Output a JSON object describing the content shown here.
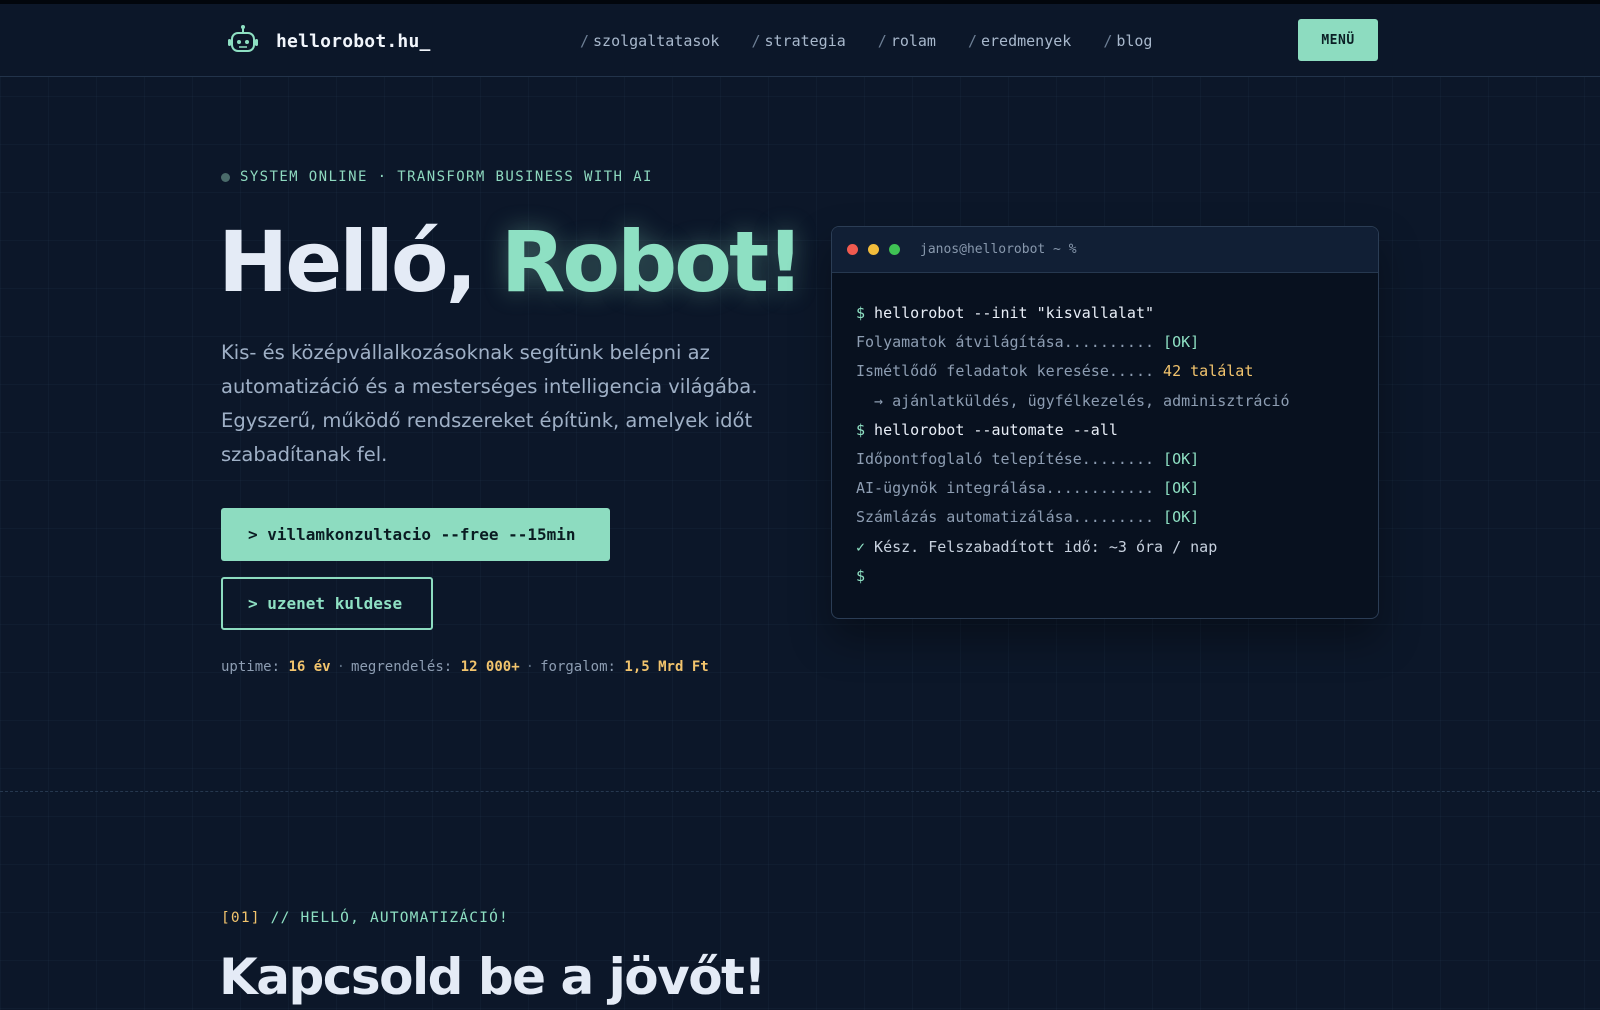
{
  "header": {
    "logo_text": "hellorobot.hu_",
    "logo_icon": "robot-icon",
    "nav": [
      {
        "slash": "/",
        "label": "szolgaltatasok"
      },
      {
        "slash": "/",
        "label": "strategia"
      },
      {
        "slash": "/",
        "label": "rolam"
      },
      {
        "slash": "/",
        "label": "eredmenyek"
      },
      {
        "slash": "/",
        "label": "blog"
      }
    ],
    "menu_label": "MENÜ"
  },
  "hero": {
    "status": "SYSTEM ONLINE · TRANSFORM BUSINESS WITH AI",
    "title_main": "Helló,",
    "title_accent": "Robot!",
    "description": "Kis- és középvállalkozásoknak segítünk belépni az automatizáció és a mesterséges intelligencia világába. Egyszerű, működő rendszereket építünk, amelyek időt szabadítanak fel.",
    "cta_primary": "> villamkonzultacio --free --15min",
    "cta_secondary": "> uzenet kuldese",
    "stats": [
      {
        "label": "uptime:",
        "value": "16 év"
      },
      {
        "label": "megrendelés:",
        "value": "12 000+"
      },
      {
        "label": "forgalom:",
        "value": "1,5 Mrd Ft"
      }
    ]
  },
  "terminal": {
    "title": "janos@hellorobot ~ %",
    "lines": {
      "l1_prompt": "$",
      "l1_cmd": " hellorobot --init \"kisvallalat\"",
      "l2_text": "Folyamatok átvilágítása.......... ",
      "l2_status": "[OK]",
      "l3_text": "Ismétlődő feladatok keresése..... ",
      "l3_status": "42 találat",
      "l4_text": "  → ajánlatküldés, ügyfélkezelés, adminisztráció",
      "l5_prompt": "$",
      "l5_cmd": " hellorobot --automate --all",
      "l6_text": "Időpontfoglaló telepítése........ ",
      "l6_status": "[OK]",
      "l7_text": "AI-ügynök integrálása............ ",
      "l7_status": "[OK]",
      "l8_text": "Számlázás automatizálása......... ",
      "l8_status": "[OK]",
      "l9_check": "✓",
      "l9_text": " Kész. Felszabadított idő: ~3 óra / nap",
      "l10_prompt": "$"
    }
  },
  "section": {
    "label_num": "[01]",
    "label_text": " // HELLÓ, AUTOMATIZÁCIÓ!",
    "title": "Kapcsold be a jövőt!"
  },
  "colors": {
    "background": "#0c1729",
    "accent": "#8ddcc0",
    "highlight": "#f2c46d"
  }
}
